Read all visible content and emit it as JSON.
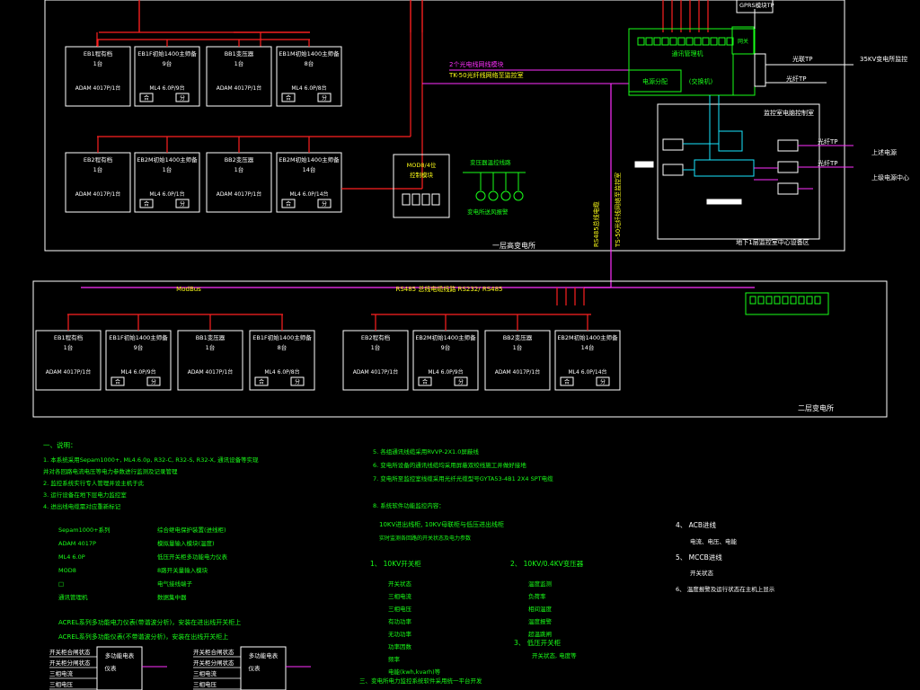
{
  "colors": {
    "background": "#000000",
    "frame": "#ffffff",
    "bus": "#ff2020",
    "comm": "#ff30ff",
    "green": "#19ff19",
    "cyan": "#19e6ff",
    "yellow": "#ffff19"
  },
  "substation1": {
    "label": "一层高变电所",
    "units_row1": [
      {
        "title": "EB1程有档",
        "count": "1台",
        "model": "ADAM 4017P/1台",
        "type": "model"
      },
      {
        "title": "EB1F初始1400主师备",
        "count": "9台",
        "model": "ML4 6.0P/9台",
        "type": "switch"
      },
      {
        "title": "BB1变压器",
        "count": "1台",
        "model": "ADAM 4017P/1台",
        "type": "model"
      },
      {
        "title": "EB1M初始1400主师备",
        "count": "8台",
        "model": "ML4 6.0P/8台",
        "type": "switch"
      }
    ],
    "units_row2": [
      {
        "title": "EB2程有档",
        "count": "1台",
        "model": "ADAM 4017P/1台",
        "type": "model"
      },
      {
        "title": "EB2M初始1400主师备",
        "count": "1台",
        "model": "ML4 6.0P/1台",
        "type": "switch"
      },
      {
        "title": "BB2变压器",
        "count": "1台",
        "model": "ADAM 4017P/1台",
        "type": "model"
      },
      {
        "title": "EB2M初始1400主师备",
        "count": "14台",
        "model": "ML4 6.0P/14台",
        "type": "switch"
      }
    ],
    "comm_module_line1": "2个光电线网线模块",
    "comm_module_line2": "TK-50光纤线网络至监控室",
    "modbus_box_line1": "MOD8/4位",
    "modbus_box_line2": "控制模块",
    "transformer_temp": "变压器温控线路",
    "alarm_label": "变电所送风报警",
    "vertical_cable": "RS485总线电缆",
    "vertical_cable2": "TS-50光纤线网络至监控室"
  },
  "control": {
    "gateway_top": "GPRS模块TP",
    "gateway_main": "通讯管理机",
    "gateway_sub": "网关",
    "power_dist": "电源分配",
    "modem": "(交换机)",
    "right_label1": "光联TP",
    "right_label2": "光纤TP",
    "ext_35kv": "35KV变电所监控",
    "room_title": "监控室电脑控制室",
    "room_caption": "地下1层监控室中心设备区",
    "out1_label": "上述电源",
    "out1_tp": "光纤TP",
    "out2_tp": "光纤TP",
    "out2_label": "上级电源中心"
  },
  "bus_line": {
    "left_tag": "ModBus",
    "center_text": "RS485 总线电缆线路 RS232/ RS485"
  },
  "substation2": {
    "label": "二层变电所",
    "units": [
      {
        "title": "EB1程有档",
        "count": "1台",
        "model": "ADAM 4017P/1台",
        "type": "model"
      },
      {
        "title": "EB1F初始1400主师备",
        "count": "9台",
        "model": "ML4 6.0P/9台",
        "type": "switch"
      },
      {
        "title": "BB1变压器",
        "count": "1台",
        "model": "ADAM 4017P/1台",
        "type": "model"
      },
      {
        "title": "EB1F初始1400主师备",
        "count": "8台",
        "model": "ML4 6.0P/8台",
        "type": "switch"
      },
      {
        "title": "EB2程有档",
        "count": "1台",
        "model": "ADAM 4017P/1台",
        "type": "model"
      },
      {
        "title": "EB2M初始1400主师备",
        "count": "9台",
        "model": "ML4 6.0P/9台",
        "type": "switch"
      },
      {
        "title": "BB2变压器",
        "count": "1台",
        "model": "ADAM 4017P/1台",
        "type": "model"
      },
      {
        "title": "EB2M初始1400主师备",
        "count": "14台",
        "model": "ML4 6.0P/14台",
        "type": "switch"
      }
    ]
  },
  "switch_labels": [
    "合",
    "分"
  ],
  "notes_left": {
    "heading": "一、说明：",
    "lines": [
      "1. 本系统采用Sepam1000+, ML4.6.0p, R32-C, R32-S, R32-X, 通讯设备等实现",
      "   并对各回路电流电压等电力参数进行监测及记录管理",
      "2. 监控系统实行专人管理并设主机于此",
      "3. 运行设备在地下层电力监控室",
      "4. 进出线电缆需对应重新标记"
    ],
    "legend": [
      {
        "key": "Sepam1000+系列",
        "desc": "综合继电保护装置(进线柜)"
      },
      {
        "key": "ADAM 4017P",
        "desc": "模拟量输入模块(温度)"
      },
      {
        "key": "ML4 6.0P",
        "desc": "低压开关柜多功能电力仪表"
      },
      {
        "key": "MOD8",
        "desc": "8路开关量输入模块"
      },
      {
        "key": "□",
        "desc": "电气接线端子"
      },
      {
        "key": "通讯管理机",
        "desc": "数据集中器"
      }
    ],
    "bold1": "ACREL系列多功能电力仪表(带谐波分析)，安装在进出线开关柜上",
    "bold2": "ACREL系列多功能仪表(不带谐波分析)，安装在出线开关柜上",
    "mini1_lines": [
      "开关柜合闸状态",
      "开关柜分闸状态",
      "三相电流",
      "三相电压"
    ],
    "mini1_box": [
      "多功能电表",
      "仪表"
    ],
    "mini2_lines": [
      "开关柜合闸状态",
      "开关柜分闸状态",
      "三相电流",
      "三相电压"
    ],
    "mini2_box": [
      "多功能电表",
      "仪表"
    ]
  },
  "notes_right": {
    "lines": [
      "5. 各组通讯线缆采用RVVP-2X1.0屏蔽线",
      "6. 变电所设备的通讯线缆均采用屏蔽双绞线施工并做好接地",
      "7. 变电所至监控室线缆采用光纤光缆型号GYTA53-4B1 2X4 SPT电缆"
    ],
    "sub8": "8. 系统软件功能监控内容：",
    "sub8b": "10KV进出线柜, 10KV母联柜与低压进出线柜",
    "sub8c": "实时监测各回路的开关状态及电力参数",
    "col1_title": "1、 10KV开关柜",
    "col1_items": [
      "开关状态",
      "三相电流",
      "三相电压",
      "有功功率",
      "无功功率",
      "功率因数",
      "频率",
      "电能(kwh,kvarh)等"
    ],
    "col2_title": "2、 10KV/0.4KV变压器",
    "col2_items": [
      "温度监测",
      "负荷率",
      "相间温度",
      "温度报警",
      "超温跳闸"
    ],
    "col2b_title": "3、 低压开关柜",
    "col2b_items": [
      "开关状态, 电度等"
    ],
    "col3_title1": "4、 ACB进线",
    "col3_items1": [
      "电流、电压、电能"
    ],
    "col3_title2": "5、 MCCB进线",
    "col3_items2": [
      "开关状态"
    ],
    "col3_title3": "6、 温度报警及运行状态在主机上显示",
    "footer": "三、变电所电力监控系统软件采用统一平台开发"
  }
}
